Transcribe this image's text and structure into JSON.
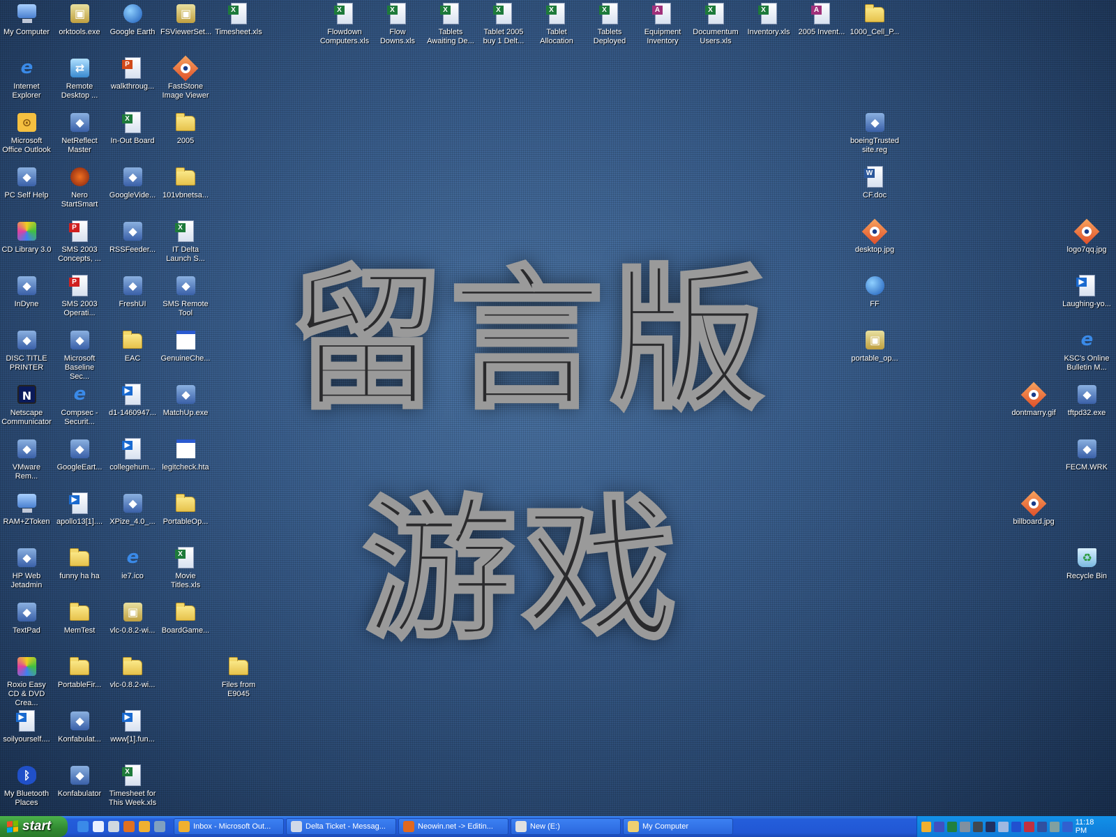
{
  "wallpaper": {
    "line1": "留言版",
    "line2": "游戏"
  },
  "desktop_icons": [
    {
      "label": "My Computer",
      "icon": "computer"
    },
    {
      "label": "orktools.exe",
      "icon": "installer"
    },
    {
      "label": "Google Earth",
      "icon": "globe"
    },
    {
      "label": "FSViewerSet...",
      "icon": "installer"
    },
    {
      "label": "Timesheet.xls",
      "icon": "excel"
    },
    {
      "label": "Internet Explorer",
      "icon": "ie"
    },
    {
      "label": "Remote Desktop ...",
      "icon": "remote"
    },
    {
      "label": "walkthroug...",
      "icon": "powerpoint"
    },
    {
      "label": "FastStone Image Viewer",
      "icon": "eye"
    },
    {
      "label": "Microsoft Office Outlook",
      "icon": "outlook"
    },
    {
      "label": "NetReflect Master",
      "icon": "app"
    },
    {
      "label": "In-Out Board",
      "icon": "excel"
    },
    {
      "label": "2005",
      "icon": "folder"
    },
    {
      "label": "PC Self Help",
      "icon": "app"
    },
    {
      "label": "Nero StartSmart",
      "icon": "nero"
    },
    {
      "label": "GoogleVide...",
      "icon": "app"
    },
    {
      "label": "101vbnetsa...",
      "icon": "folder"
    },
    {
      "label": "CD Library 3.0",
      "icon": "cd"
    },
    {
      "label": "SMS 2003 Concepts, ...",
      "icon": "pdf"
    },
    {
      "label": "RSSFeeder...",
      "icon": "app"
    },
    {
      "label": "IT Delta Launch S...",
      "icon": "excel"
    },
    {
      "label": "InDyne",
      "icon": "app"
    },
    {
      "label": "SMS 2003 Operati...",
      "icon": "pdf"
    },
    {
      "label": "FreshUI",
      "icon": "app"
    },
    {
      "label": "SMS Remote Tool",
      "icon": "app"
    },
    {
      "label": "DISC TITLE PRINTER",
      "icon": "app"
    },
    {
      "label": "Microsoft Baseline Sec...",
      "icon": "app"
    },
    {
      "label": "EAC",
      "icon": "folder"
    },
    {
      "label": "GenuineChe...",
      "icon": "window"
    },
    {
      "label": "Netscape Communicator",
      "icon": "netscape"
    },
    {
      "label": "Compsec - Securit...",
      "icon": "ie"
    },
    {
      "label": "d1-1460947...",
      "icon": "media"
    },
    {
      "label": "MatchUp.exe",
      "icon": "app"
    },
    {
      "label": "VMware Rem...",
      "icon": "app"
    },
    {
      "label": "GoogleEart...",
      "icon": "app"
    },
    {
      "label": "collegehum...",
      "icon": "media"
    },
    {
      "label": "legitcheck.hta",
      "icon": "window"
    },
    {
      "label": "RAM+ZToken",
      "icon": "computer"
    },
    {
      "label": "apollo13[1]....",
      "icon": "media"
    },
    {
      "label": "XPize_4.0_...",
      "icon": "app"
    },
    {
      "label": "PortableOp...",
      "icon": "folder"
    },
    {
      "label": "HP Web Jetadmin",
      "icon": "app"
    },
    {
      "label": "funny ha ha",
      "icon": "folder"
    },
    {
      "label": "ie7.ico",
      "icon": "ie"
    },
    {
      "label": "Movie Titles.xls",
      "icon": "excel"
    },
    {
      "label": "TextPad",
      "icon": "app"
    },
    {
      "label": "MemTest",
      "icon": "folder"
    },
    {
      "label": "vlc-0.8.2-wi...",
      "icon": "installer"
    },
    {
      "label": "BoardGame...",
      "icon": "folder"
    },
    {
      "label": "Roxio Easy CD & DVD Crea...",
      "icon": "cd"
    },
    {
      "label": "PortableFir...",
      "icon": "folder"
    },
    {
      "label": "vlc-0.8.2-wi...",
      "icon": "folder"
    },
    {
      "label": "Files from E9045",
      "icon": "folder"
    },
    {
      "label": "soilyourself....",
      "icon": "media"
    },
    {
      "label": "Konfabulat...",
      "icon": "app"
    },
    {
      "label": "www[1].fun...",
      "icon": "media"
    },
    {
      "label": "My Bluetooth Places",
      "icon": "bluetooth"
    },
    {
      "label": "Konfabulator",
      "icon": "app"
    },
    {
      "label": "Timesheet for This Week.xls",
      "icon": "excel"
    },
    {
      "label": "Flowdown Computers.xls",
      "icon": "excel"
    },
    {
      "label": "Flow Downs.xls",
      "icon": "excel"
    },
    {
      "label": "Tablets Awaiting De...",
      "icon": "excel"
    },
    {
      "label": "Tablet 2005 buy 1 Delt...",
      "icon": "excel"
    },
    {
      "label": "Tablet Allocation",
      "icon": "excel"
    },
    {
      "label": "Tablets Deployed",
      "icon": "excel"
    },
    {
      "label": "Equipment Inventory",
      "icon": "access"
    },
    {
      "label": "Documentum Users.xls",
      "icon": "excel"
    },
    {
      "label": "Inventory.xls",
      "icon": "excel"
    },
    {
      "label": "2005 Invent...",
      "icon": "access"
    },
    {
      "label": "1000_Cell_P...",
      "icon": "folder"
    },
    {
      "label": "boeingTrusted site.reg",
      "icon": "app"
    },
    {
      "label": "CF.doc",
      "icon": "word"
    },
    {
      "label": "desktop.jpg",
      "icon": "eye"
    },
    {
      "label": "FF",
      "icon": "globe"
    },
    {
      "label": "portable_op...",
      "icon": "installer"
    },
    {
      "label": "logo7qq.jpg",
      "icon": "eye"
    },
    {
      "label": "Laughing-yo...",
      "icon": "media"
    },
    {
      "label": "KSC's Online Bulletin M...",
      "icon": "ie"
    },
    {
      "label": "dontmarry.gif",
      "icon": "eye"
    },
    {
      "label": "tftpd32.exe",
      "icon": "app"
    },
    {
      "label": "FECM.WRK",
      "icon": "app"
    },
    {
      "label": "billboard.jpg",
      "icon": "eye"
    },
    {
      "label": "Recycle Bin",
      "icon": "recycle-bin"
    }
  ],
  "taskbar": {
    "start_label": "start",
    "quick_launch": [
      "ie",
      "outlook-express",
      "media",
      "firefox",
      "outlook",
      "network"
    ],
    "tasks": [
      {
        "label": "Inbox - Microsoft Out...",
        "color": "#f0b030"
      },
      {
        "label": "Delta Ticket - Messag...",
        "color": "#d0d8e8"
      },
      {
        "label": "Neowin.net -> Editin...",
        "color": "#e06820"
      },
      {
        "label": "New (E:)",
        "color": "#e0e0e0"
      },
      {
        "label": "My Computer",
        "color": "#f0d070"
      }
    ],
    "tray_icons": [
      "#f0b030",
      "#4050c0",
      "#208040",
      "#8090a0",
      "#404850",
      "#203060",
      "#a0b8e0",
      "#2050d0",
      "#c03040",
      "#3050a0",
      "#80a0a0",
      "#3060d0"
    ],
    "clock": "11:18 PM"
  }
}
